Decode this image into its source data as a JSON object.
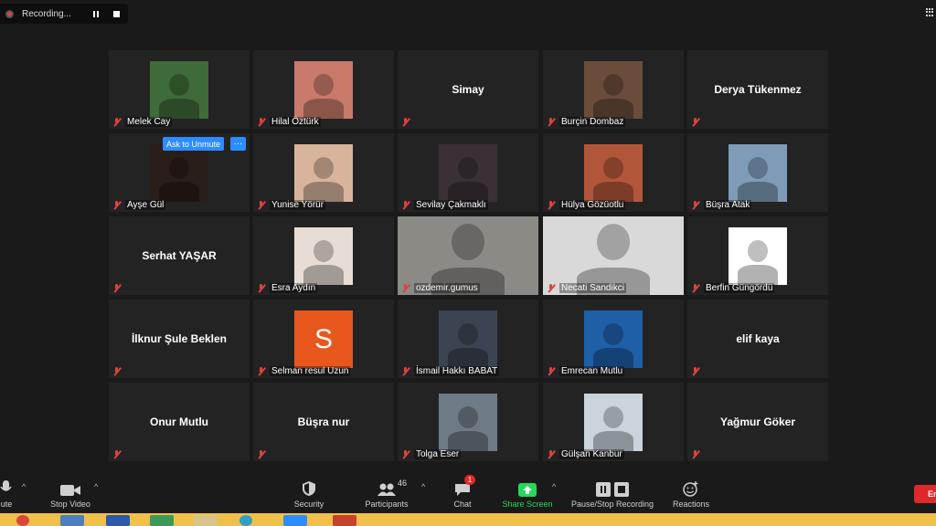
{
  "recording": {
    "label": "Recording..."
  },
  "tiles": [
    {
      "name": "Melek Cay",
      "type": "photo",
      "bg": "#3f6a3a"
    },
    {
      "name": "Hilal Öztürk",
      "type": "photo",
      "bg": "#c97a6a"
    },
    {
      "name": "Simay",
      "type": "name"
    },
    {
      "name": "Burçin Dombaz",
      "type": "photo",
      "bg": "#6b4c3b"
    },
    {
      "name": "Derya Tükenmez",
      "type": "name"
    },
    {
      "name": "Ayşe Gül",
      "type": "photo",
      "bg": "#2a1e1a"
    },
    {
      "name": "Yunise Yörür",
      "type": "photo",
      "bg": "#d9b49c"
    },
    {
      "name": "Sevilay Çakmaklı",
      "type": "photo",
      "bg": "#3a3036"
    },
    {
      "name": "Hülya Gözüotlu",
      "type": "photo",
      "bg": "#b2563a"
    },
    {
      "name": "Büşra Atak",
      "type": "photo",
      "bg": "#7f9bb8"
    },
    {
      "name": "Serhat YAŞAR",
      "type": "name"
    },
    {
      "name": "Esra Aydın",
      "type": "photo",
      "bg": "#e8ddd4"
    },
    {
      "name": "ozdemir.gumus",
      "type": "video",
      "bg": "#8c8a84"
    },
    {
      "name": "Necati Sandikci",
      "type": "video",
      "bg": "#d9d9d9"
    },
    {
      "name": "Berfin Güngördü",
      "type": "photo",
      "bg": "#ffffff"
    },
    {
      "name": "İlknur Şule Beklen",
      "type": "name"
    },
    {
      "name": "Selman resul Uzun",
      "type": "avatar",
      "letter": "S",
      "bg": "#e8571c"
    },
    {
      "name": "İsmail Hakkı BABAT",
      "type": "photo",
      "bg": "#3b4452"
    },
    {
      "name": "Emrecan Mutlu",
      "type": "photo",
      "bg": "#1f5fa8"
    },
    {
      "name": "elif kaya",
      "type": "name"
    },
    {
      "name": "Onur Mutlu",
      "type": "name"
    },
    {
      "name": "Büşra nur",
      "type": "name"
    },
    {
      "name": "Tolga Eser",
      "type": "photo",
      "bg": "#6e7a86"
    },
    {
      "name": "Gülşan Kanbur",
      "type": "photo",
      "bg": "#c9d4dc"
    },
    {
      "name": "Yağmur Göker",
      "type": "name"
    }
  ],
  "ask_unmute": {
    "label": "Ask to Unmute",
    "more": "···"
  },
  "toolbar": {
    "unmute": "ute",
    "stop_video": "Stop Video",
    "security": "Security",
    "participants": "Participants",
    "participants_count": "46",
    "chat": "Chat",
    "chat_badge": "1",
    "share_screen": "Share Screen",
    "recording": "Pause/Stop Recording",
    "reactions": "Reactions",
    "end": "En"
  },
  "colors": {
    "share": "#23d959",
    "end": "#e02828",
    "accent": "#2d8cff"
  }
}
